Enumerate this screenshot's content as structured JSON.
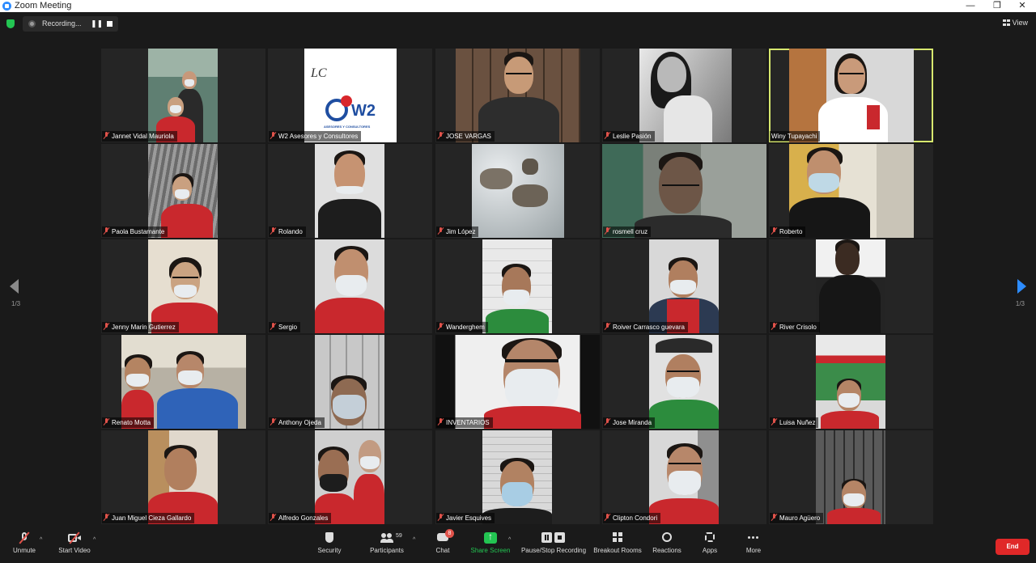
{
  "window": {
    "title": "Zoom Meeting",
    "minimize": "—",
    "maximize": "❐",
    "close": "✕"
  },
  "topbar": {
    "recording_label": "Recording...",
    "pause_glyph": "❚❚",
    "view_label": "View"
  },
  "pager": {
    "left": "1/3",
    "right": "1/3"
  },
  "participants": [
    {
      "name": "Jannet Vidal Mauriola"
    },
    {
      "name": "W2 Asesores y Consultores"
    },
    {
      "name": "JOSE VARGAS"
    },
    {
      "name": "Leslie Pasión"
    },
    {
      "name": "Winy Tupayachi"
    },
    {
      "name": "Paola Bustamante"
    },
    {
      "name": "Rolando"
    },
    {
      "name": "Jim López"
    },
    {
      "name": "rosmell cruz"
    },
    {
      "name": "Roberto"
    },
    {
      "name": "Jenny Marin Gutierrez"
    },
    {
      "name": "Sergio"
    },
    {
      "name": "Wanderghem"
    },
    {
      "name": "Roiver Carrasco guevara"
    },
    {
      "name": "River Crisolo"
    },
    {
      "name": "Renato Motta"
    },
    {
      "name": "Anthony Ojeda"
    },
    {
      "name": "INVENTARIOS"
    },
    {
      "name": "Jose Miranda"
    },
    {
      "name": "Luisa Nuñez"
    },
    {
      "name": "Juan Miguel Cieza Gallardo"
    },
    {
      "name": "Alfredo Gonzales"
    },
    {
      "name": "Javier Esquives"
    },
    {
      "name": "Clipton Condori"
    },
    {
      "name": "Mauro Agüero"
    }
  ],
  "w2_logo": {
    "line1": "LC",
    "brand": "W2",
    "tag": "ASESORES Y CONSULTORES"
  },
  "toolbar": {
    "unmute": "Unmute",
    "start_video": "Start Video",
    "security": "Security",
    "participants": "Participants",
    "participants_count": "59",
    "chat": "Chat",
    "chat_badge": "8",
    "share_screen": "Share Screen",
    "pause_stop": "Pause/Stop Recording",
    "breakout": "Breakout Rooms",
    "reactions": "Reactions",
    "apps": "Apps",
    "more": "More",
    "end": "End"
  }
}
